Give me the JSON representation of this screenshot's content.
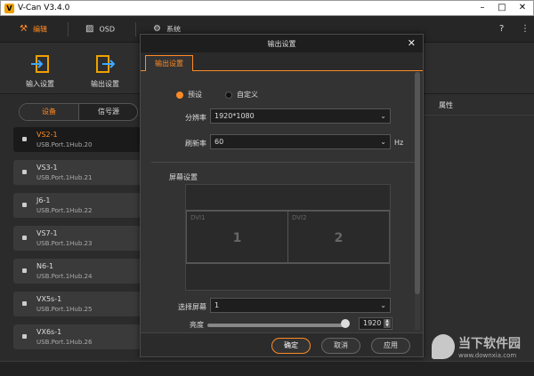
{
  "window": {
    "title": "V-Can V3.4.0",
    "logo": "V",
    "minimize": "–",
    "restore": "□",
    "close": "✕"
  },
  "topnav": {
    "tabs": [
      {
        "label": "编辑",
        "icon": "layout-icon",
        "glyph": "⚒",
        "active": true
      },
      {
        "label": "OSD",
        "icon": "image-icon",
        "glyph": "▨",
        "active": false
      },
      {
        "label": "系统",
        "icon": "gear-icon",
        "glyph": "⚙",
        "active": false
      }
    ],
    "help": "?",
    "settings": "⋮"
  },
  "toolbar": {
    "buttons": [
      {
        "label": "输入设置",
        "icon": "input-settings-icon"
      },
      {
        "label": "输出设置",
        "icon": "output-settings-icon"
      }
    ]
  },
  "leftpanel": {
    "segments": [
      "设备",
      "信号源"
    ],
    "devices": [
      {
        "name": "VS2-1",
        "port": "USB.Port.1Hub.20",
        "active": true
      },
      {
        "name": "VS3-1",
        "port": "USB.Port.1Hub.21",
        "active": false
      },
      {
        "name": "J6-1",
        "port": "USB.Port.1Hub.22",
        "active": false
      },
      {
        "name": "VS7-1",
        "port": "USB.Port.1Hub.23",
        "active": false
      },
      {
        "name": "N6-1",
        "port": "USB.Port.1Hub.24",
        "active": false
      },
      {
        "name": "VX5s-1",
        "port": "USB.Port.1Hub.25",
        "active": false
      },
      {
        "name": "VX6s-1",
        "port": "USB.Port.1Hub.26",
        "active": false
      }
    ]
  },
  "rightpanel": {
    "header": "属性"
  },
  "dialog": {
    "title": "输出设置",
    "close": "✕",
    "tab": "输出设置",
    "mode": {
      "preset": "预设",
      "custom": "自定义",
      "selected": "preset"
    },
    "resolution_label": "分辨率",
    "resolution_value": "1920*1080",
    "refresh_label": "刷新率",
    "refresh_value": "60",
    "refresh_unit": "Hz",
    "screen_section": "屏幕设置",
    "screen_cells": [
      {
        "label": "DVI1",
        "number": "1"
      },
      {
        "label": "DVI2",
        "number": "2"
      }
    ],
    "select_screen_label": "选择屏幕",
    "select_screen_value": "1",
    "brightness_label": "亮度",
    "brightness_value": "1920",
    "buttons": {
      "ok": "确定",
      "cancel": "取消",
      "apply": "应用"
    }
  },
  "watermark": {
    "title": "当下软件园",
    "url": "www.downxia.com"
  },
  "colors": {
    "accent": "#ff8a24",
    "background": "#2b2b2b",
    "dialog": "#333333"
  }
}
